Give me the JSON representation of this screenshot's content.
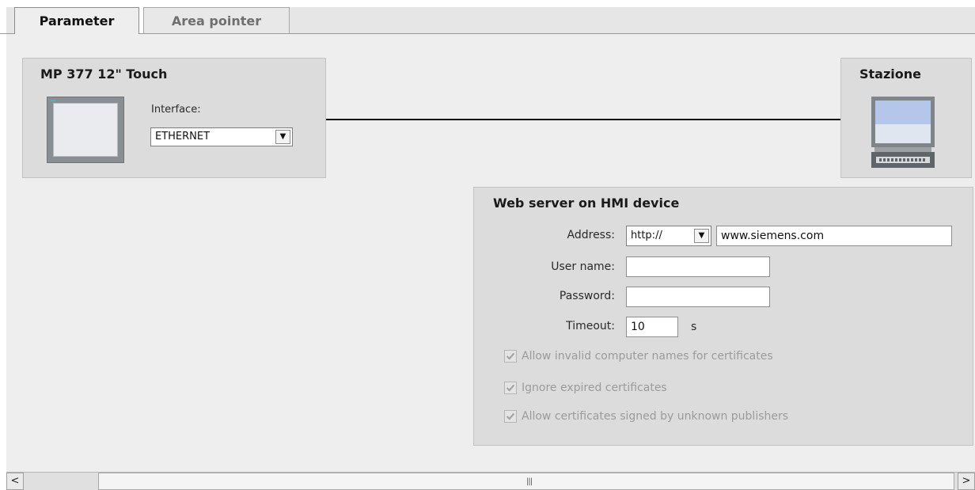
{
  "tabs": [
    {
      "label": "Parameter",
      "active": true
    },
    {
      "label": "Area pointer",
      "active": false
    }
  ],
  "device": {
    "title": "MP 377 12\" Touch",
    "interface_label": "Interface:",
    "interface_value": "ETHERNET",
    "icon": "hmi-panel-icon"
  },
  "station": {
    "title": "Stazione",
    "icon": "pc-station-icon"
  },
  "web_server": {
    "title": "Web server on HMI device",
    "address_label": "Address:",
    "protocol_value": "http://",
    "address_value": "www.siemens.com",
    "username_label": "User name:",
    "username_value": "",
    "password_label": "Password:",
    "password_value": "",
    "timeout_label": "Timeout:",
    "timeout_value": "10",
    "timeout_unit": "s",
    "checkboxes": [
      {
        "label": "Allow invalid computer names for certificates",
        "checked": true,
        "enabled": false
      },
      {
        "label": "Ignore expired certificates",
        "checked": true,
        "enabled": false
      },
      {
        "label": "Allow certificates signed by unknown publishers",
        "checked": true,
        "enabled": false
      }
    ]
  },
  "scrollbar": {
    "left_arrow": "<",
    "right_arrow": ">",
    "grip": "|||"
  },
  "colors": {
    "panel": "#dcdcdc",
    "background": "#eeeeee",
    "disabled_text": "#9b9b9b"
  }
}
